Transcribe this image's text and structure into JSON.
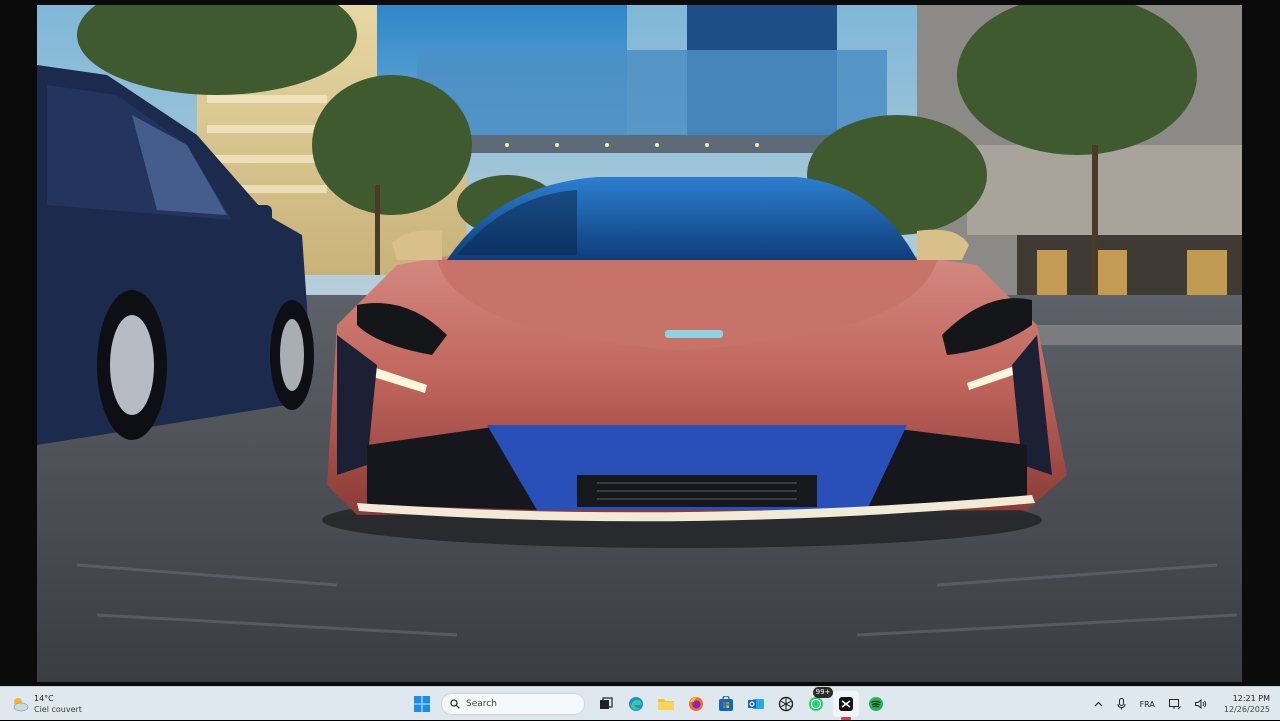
{
  "video": {
    "scene": ""
  },
  "taskbar": {
    "weather": {
      "temp": "14°C",
      "desc": "Ciel couvert",
      "icon": "cloud-sun-icon"
    },
    "search": {
      "placeholder": "Search"
    },
    "apps": [
      {
        "name": "windows-start",
        "icon": "windows-icon"
      },
      {
        "name": "task-view",
        "icon": "task-view-icon"
      },
      {
        "name": "edge",
        "icon": "edge-icon"
      },
      {
        "name": "file-explorer",
        "icon": "folder-icon"
      },
      {
        "name": "firefox",
        "icon": "firefox-icon"
      },
      {
        "name": "microsoft-store",
        "icon": "store-icon"
      },
      {
        "name": "outlook",
        "icon": "outlook-icon"
      },
      {
        "name": "chatgpt",
        "icon": "chatgpt-icon"
      },
      {
        "name": "whatsapp",
        "icon": "whatsapp-icon",
        "badge": "99+"
      },
      {
        "name": "capcut",
        "icon": "capcut-icon",
        "active": true
      },
      {
        "name": "spotify",
        "icon": "spotify-icon"
      }
    ],
    "tray": {
      "language": "FRA",
      "time": "12:21 PM",
      "date": "12/26/2025"
    },
    "colors": {
      "taskbar_bg": "#dfe7ef",
      "active_indicator": "#e0354a",
      "spotify": "#1db954",
      "whatsapp": "#25d366"
    }
  }
}
